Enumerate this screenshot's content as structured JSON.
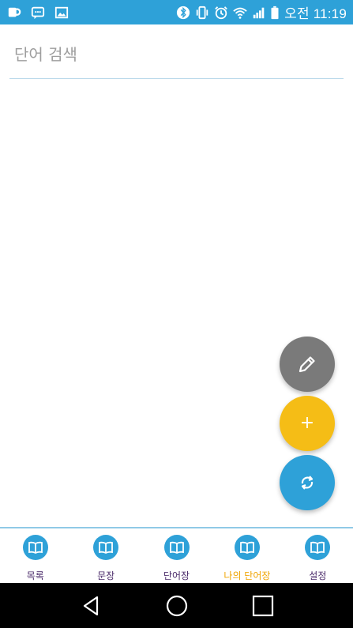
{
  "status_bar": {
    "time": "오전 11:19",
    "left_icons": [
      "app-notification-icon",
      "chat-notification-icon",
      "image-notification-icon"
    ],
    "right_icons": [
      "bluetooth-icon",
      "vibrate-icon",
      "alarm-icon",
      "wifi-icon",
      "signal-icon",
      "battery-icon"
    ],
    "color": "#2ea1d8"
  },
  "search": {
    "placeholder": "단어 검색",
    "value": ""
  },
  "fabs": [
    {
      "name": "edit",
      "icon": "pencil-icon",
      "color": "#7a7a7a"
    },
    {
      "name": "add",
      "icon": "plus-icon",
      "label": "+",
      "color": "#f5bd16"
    },
    {
      "name": "refresh",
      "icon": "refresh-icon",
      "color": "#2ea1d8"
    }
  ],
  "bottom_nav": {
    "items": [
      {
        "label": "목록",
        "icon": "book-icon",
        "active": false
      },
      {
        "label": "문장",
        "icon": "book-icon",
        "active": false
      },
      {
        "label": "단어장",
        "icon": "book-icon",
        "active": false
      },
      {
        "label": "나의 단어장",
        "icon": "book-icon",
        "active": true
      },
      {
        "label": "설정",
        "icon": "book-icon",
        "active": false
      }
    ],
    "active_color": "#f0a400",
    "label_color": "#4a2a6a"
  },
  "system_nav": {
    "buttons": [
      "back-icon",
      "home-icon",
      "recents-icon"
    ]
  }
}
